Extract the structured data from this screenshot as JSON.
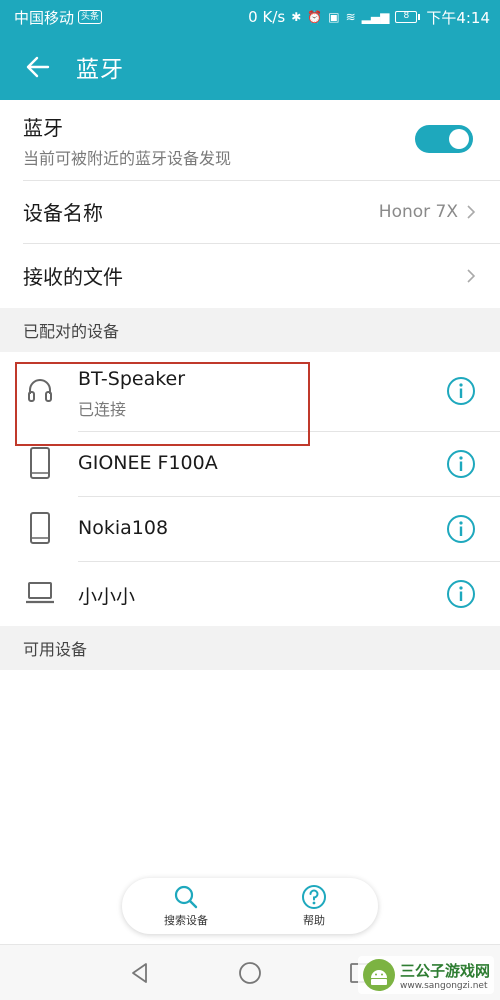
{
  "status_bar": {
    "carrier": "中国移动",
    "carrier_badge": "头条",
    "net_speed": "0 K/s",
    "battery_level": "8",
    "time": "下午4:14"
  },
  "header": {
    "title": "蓝牙",
    "bg_color": "#1ea8bd"
  },
  "bluetooth": {
    "label": "蓝牙",
    "subtitle": "当前可被附近的蓝牙设备发现",
    "enabled": true
  },
  "device_name": {
    "label": "设备名称",
    "value": "Honor 7X"
  },
  "received_files": {
    "label": "接收的文件"
  },
  "paired": {
    "title": "已配对的设备",
    "devices": [
      {
        "name": "BT-Speaker",
        "status": "已连接",
        "icon": "headphones-icon"
      },
      {
        "name": "GIONEE F100A",
        "status": "",
        "icon": "phone-icon"
      },
      {
        "name": "Nokia108",
        "status": "",
        "icon": "phone-icon"
      },
      {
        "name": "小小小",
        "status": "",
        "icon": "laptop-icon"
      }
    ]
  },
  "available": {
    "title": "可用设备"
  },
  "bottom_actions": {
    "search_label": "搜索设备",
    "help_label": "帮助"
  },
  "watermark": {
    "title": "三公子游戏网",
    "url": "www.sangongzi.net"
  },
  "colors": {
    "accent": "#1ea8bd",
    "highlight": "#c0392b"
  }
}
